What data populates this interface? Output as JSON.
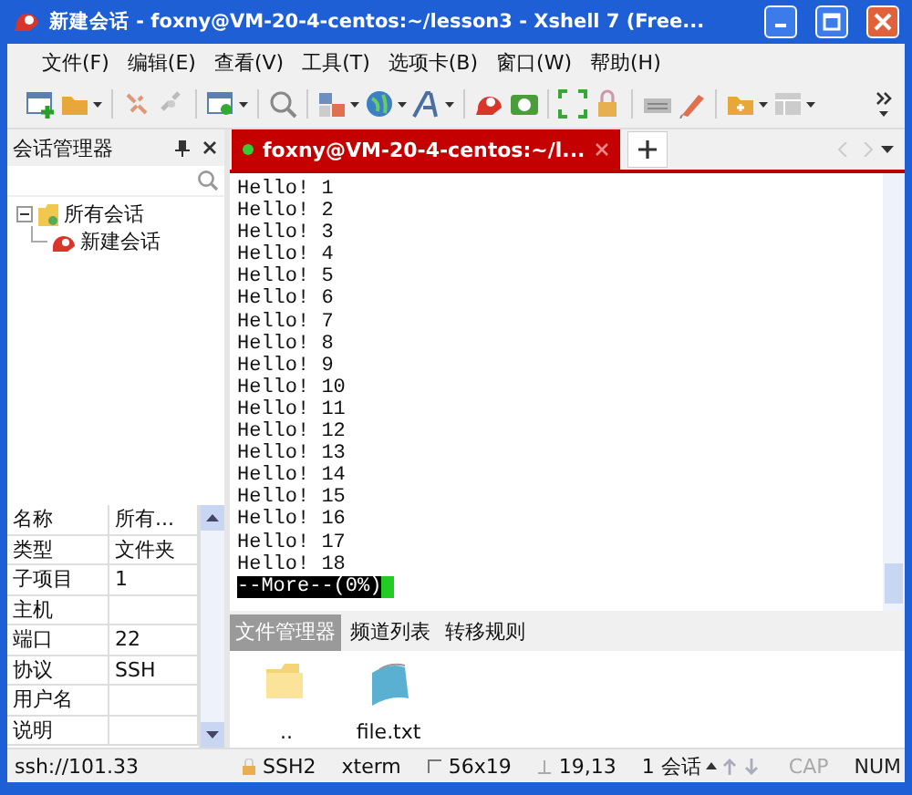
{
  "window": {
    "title": "新建会话 - foxny@VM-20-4-centos:~/lesson3 - Xshell 7 (Free..."
  },
  "menu": [
    "文件(F)",
    "编辑(E)",
    "查看(V)",
    "工具(T)",
    "选项卡(B)",
    "窗口(W)",
    "帮助(H)"
  ],
  "session_manager": {
    "title": "会话管理器",
    "tree": [
      {
        "label": "所有会话",
        "expanded": true,
        "children": [
          {
            "label": "新建会话"
          }
        ]
      }
    ],
    "properties": [
      {
        "name": "名称",
        "value": "所有..."
      },
      {
        "name": "类型",
        "value": "文件夹"
      },
      {
        "name": "子项目",
        "value": "1"
      },
      {
        "name": "主机"
      },
      {
        "name": "端口",
        "value": "22"
      },
      {
        "name": "协议",
        "value": "SSH"
      },
      {
        "name": "用户名"
      },
      {
        "name": "说明"
      }
    ]
  },
  "tabs": [
    {
      "label": "foxny@VM-20-4-centos:~/l...",
      "selected": true,
      "connected": true
    }
  ],
  "terminal": {
    "lines": [
      "Hello! 1",
      "Hello! 2",
      "Hello! 3",
      "Hello! 4",
      "Hello! 5",
      "Hello! 6",
      "Hello! 7",
      "Hello! 8",
      "Hello! 9",
      "Hello! 10",
      "Hello! 11",
      "Hello! 12",
      "Hello! 13",
      "Hello! 14",
      "Hello! 15",
      "Hello! 16",
      "Hello! 17",
      "Hello! 18"
    ],
    "pager": "--More--(0%)"
  },
  "bottom_tabs": [
    {
      "label": "文件管理器",
      "selected": true
    },
    {
      "label": "频道列表",
      "selected": false
    },
    {
      "label": "转移规则",
      "selected": false
    }
  ],
  "files": [
    {
      "name": "..",
      "kind": "folder"
    },
    {
      "name": "file.txt",
      "kind": "text"
    }
  ],
  "status_bar": {
    "address": "ssh://101.33",
    "items": [
      {
        "kind": "lock",
        "text": "SSH2"
      },
      {
        "kind": "plain",
        "text": "xterm"
      },
      {
        "kind": "size",
        "text": "56x19"
      },
      {
        "kind": "cursor",
        "text": "19,13"
      },
      {
        "kind": "sessions",
        "text": "1 会话"
      }
    ],
    "indicators": [
      {
        "label": "CAP",
        "on": false
      },
      {
        "label": "NUM",
        "on": true
      }
    ]
  }
}
